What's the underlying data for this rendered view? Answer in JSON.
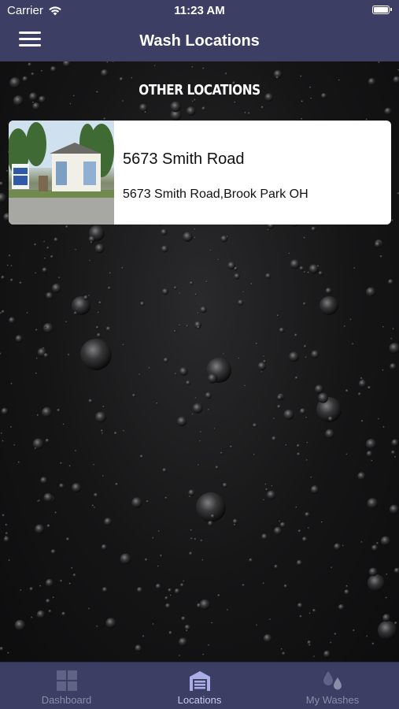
{
  "status_bar": {
    "carrier": "Carrier",
    "time": "11:23 AM"
  },
  "nav_bar": {
    "title": "Wash Locations",
    "menu_icon": "hamburger-menu-icon"
  },
  "section": {
    "header": "OTHER LOCATIONS"
  },
  "locations": [
    {
      "name": "5673 Smith Road",
      "address": "5673 Smith Road,Brook Park OH"
    }
  ],
  "tab_bar": {
    "tabs": [
      {
        "label": "Dashboard",
        "icon": "grid-icon",
        "active": false
      },
      {
        "label": "Locations",
        "icon": "garage-icon",
        "active": true
      },
      {
        "label": "My Washes",
        "icon": "water-drops-icon",
        "active": false
      }
    ]
  },
  "colors": {
    "bar_background": "#3c3f63",
    "active_tab": "#c7cbf0",
    "inactive_tab": "#8a8ca8",
    "content_background": "#151516"
  }
}
